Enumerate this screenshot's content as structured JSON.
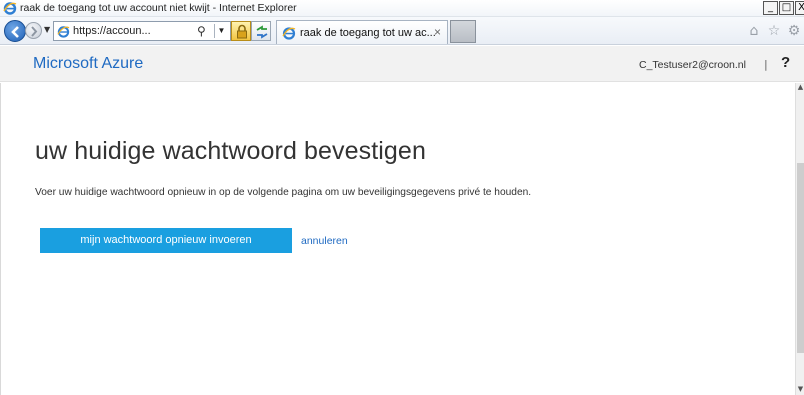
{
  "window": {
    "title": "raak de toegang tot uw account niet kwijt - Internet Explorer",
    "controls": {
      "minimize": "_",
      "maximize": "□",
      "close": "X"
    }
  },
  "navbar": {
    "address_url": "https://accoun...",
    "tab_label": "raak de toegang tot uw ac...",
    "tab_close": "×",
    "right_icons": [
      "home-icon",
      "star-icon",
      "gear-icon"
    ]
  },
  "header": {
    "brand": "Microsoft Azure",
    "user_email": "C_Testuser2@croon.nl",
    "separator": "|",
    "help": "?"
  },
  "main": {
    "title": "uw huidige wachtwoord bevestigen",
    "description": "Voer uw huidige wachtwoord opnieuw in op de volgende pagina om uw beveiligingsgegevens privé te houden.",
    "primary_button": "mijn wachtwoord opnieuw invoeren",
    "cancel_link": "annuleren"
  },
  "colors": {
    "accent": "#1a9fe0",
    "link": "#1f6ac2",
    "header_bg": "#f2f2f2"
  }
}
